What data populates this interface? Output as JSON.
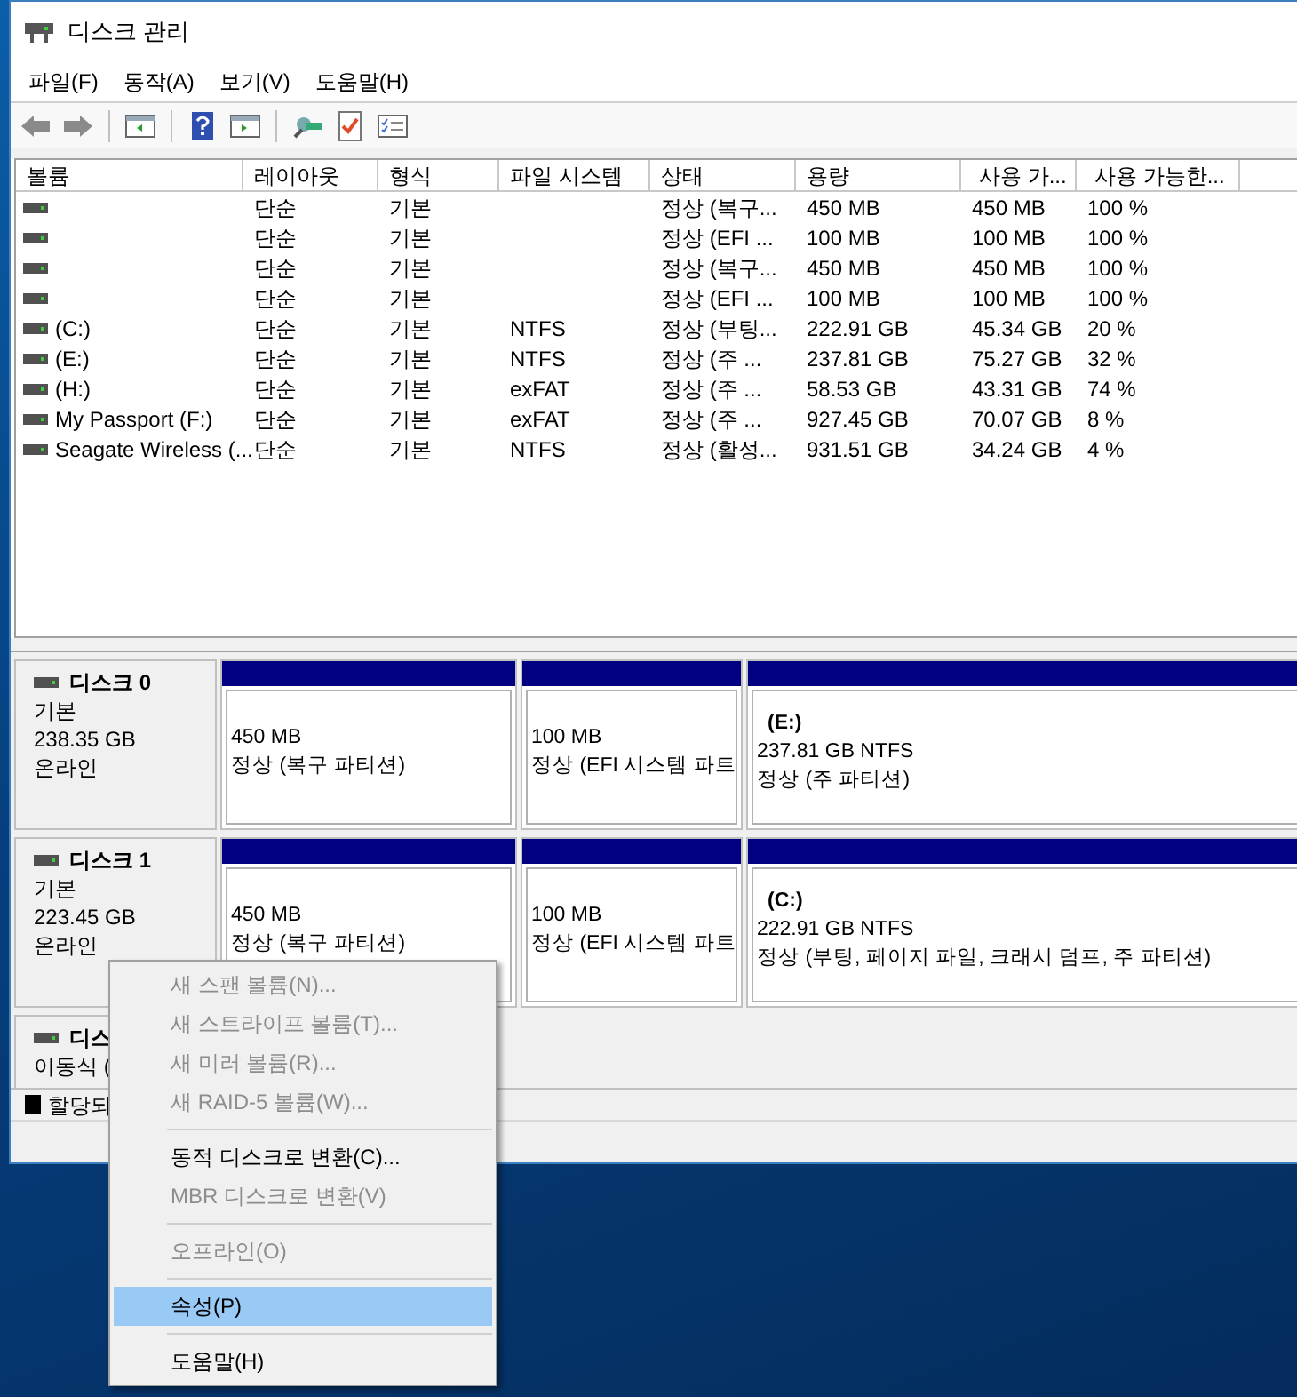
{
  "window": {
    "title": "디스크 관리"
  },
  "menu_bar": [
    "파일(F)",
    "동작(A)",
    "보기(V)",
    "도움말(H)"
  ],
  "volume_table": {
    "columns": [
      "볼륨",
      "레이아웃",
      "형식",
      "파일 시스템",
      "상태",
      "용량",
      "사용 가...",
      "사용 가능한..."
    ],
    "rows": [
      {
        "layout": "단순",
        "type": "기본",
        "status": "정상 (복구...",
        "capacity": "450 MB",
        "free": "450 MB",
        "free_pct": "100 %"
      },
      {
        "layout": "단순",
        "type": "기본",
        "status": "정상 (EFI ...",
        "capacity": "100 MB",
        "free": "100 MB",
        "free_pct": "100 %"
      },
      {
        "layout": "단순",
        "type": "기본",
        "status": "정상 (복구...",
        "capacity": "450 MB",
        "free": "450 MB",
        "free_pct": "100 %"
      },
      {
        "layout": "단순",
        "type": "기본",
        "status": "정상 (EFI ...",
        "capacity": "100 MB",
        "free": "100 MB",
        "free_pct": "100 %"
      },
      {
        "volume": "(C:)",
        "layout": "단순",
        "type": "기본",
        "file_system": "NTFS",
        "status": "정상 (부팅...",
        "capacity": "222.91 GB",
        "free": "45.34 GB",
        "free_pct": "20 %"
      },
      {
        "volume": "(E:)",
        "layout": "단순",
        "type": "기본",
        "file_system": "NTFS",
        "status": "정상 (주 ...",
        "capacity": "237.81 GB",
        "free": "75.27 GB",
        "free_pct": "32 %"
      },
      {
        "volume": "(H:)",
        "layout": "단순",
        "type": "기본",
        "file_system": "exFAT",
        "status": "정상 (주 ...",
        "capacity": "58.53 GB",
        "free": "43.31 GB",
        "free_pct": "74 %"
      },
      {
        "volume": "My Passport (F:)",
        "layout": "단순",
        "type": "기본",
        "file_system": "exFAT",
        "status": "정상 (주 ...",
        "capacity": "927.45 GB",
        "free": "70.07 GB",
        "free_pct": "8 %"
      },
      {
        "volume": "Seagate Wireless (...",
        "layout": "단순",
        "type": "기본",
        "file_system": "NTFS",
        "status": "정상 (활성...",
        "capacity": "931.51 GB",
        "free": "34.24 GB",
        "free_pct": "4 %"
      }
    ]
  },
  "disks": [
    {
      "name": "디스크 0",
      "type": "기본",
      "size": "238.35 GB",
      "status": "온라인",
      "partitions": [
        {
          "size": "450 MB",
          "status": "정상 (복구 파티션)"
        },
        {
          "size": "100 MB",
          "status": "정상 (EFI 시스템 파트"
        },
        {
          "label": "(E:)",
          "size": "237.81 GB NTFS",
          "status": "정상 (주 파티션)"
        }
      ]
    },
    {
      "name": "디스크 1",
      "type": "기본",
      "size": "223.45 GB",
      "status": "온라인",
      "partitions": [
        {
          "size": "450 MB",
          "status": "정상 (복구 파티션)"
        },
        {
          "size": "100 MB",
          "status": "정상 (EFI 시스템 파트"
        },
        {
          "label": "(C:)",
          "size": "222.91 GB NTFS",
          "status": "정상 (부팅, 페이지 파일, 크래시 덤프, 주 파티션)"
        }
      ]
    },
    {
      "name": "디스",
      "type": "이동식 ("
    }
  ],
  "legend": [
    {
      "label": "할당되",
      "color": "#000000"
    }
  ],
  "context_menu": [
    {
      "kind": "item",
      "label": "새 스팬 볼륨(N)...",
      "disabled": true,
      "selected": false
    },
    {
      "kind": "item",
      "label": "새 스트라이프 볼륨(T)...",
      "disabled": true,
      "selected": false
    },
    {
      "kind": "item",
      "label": "새 미러 볼륨(R)...",
      "disabled": true,
      "selected": false
    },
    {
      "kind": "item",
      "label": "새 RAID-5 볼륨(W)...",
      "disabled": true,
      "selected": false
    },
    {
      "kind": "separator"
    },
    {
      "kind": "item",
      "label": "동적 디스크로 변환(C)...",
      "disabled": false,
      "selected": false
    },
    {
      "kind": "item",
      "label": "MBR 디스크로 변환(V)",
      "disabled": true,
      "selected": false
    },
    {
      "kind": "separator"
    },
    {
      "kind": "item",
      "label": "오프라인(O)",
      "disabled": true,
      "selected": false
    },
    {
      "kind": "separator"
    },
    {
      "kind": "item",
      "label": "속성(P)",
      "disabled": false,
      "selected": true
    },
    {
      "kind": "separator"
    },
    {
      "kind": "item",
      "label": "도움말(H)",
      "disabled": false,
      "selected": false
    }
  ]
}
